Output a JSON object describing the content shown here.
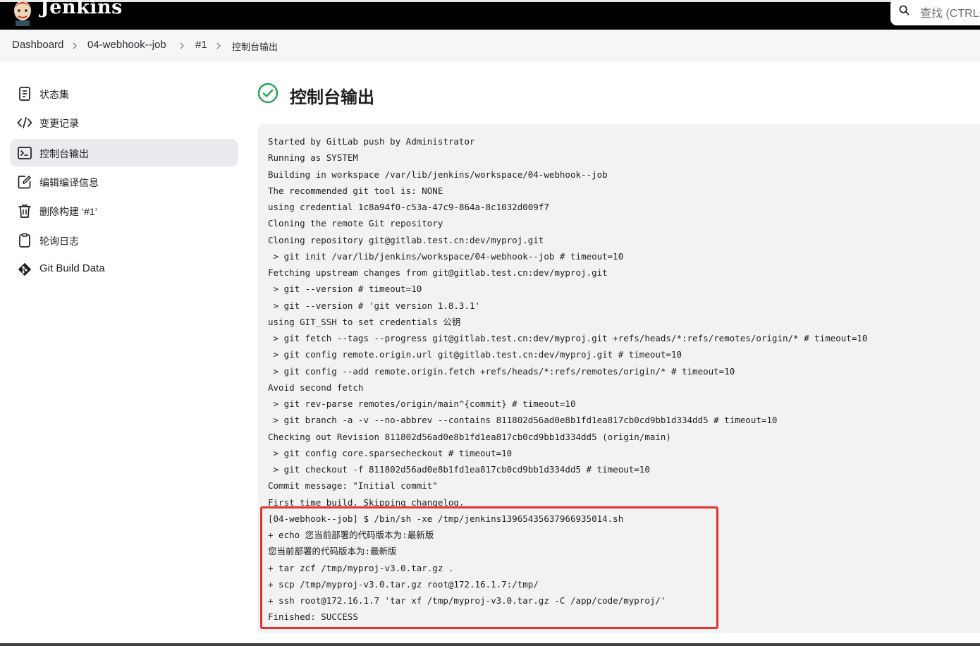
{
  "header": {
    "brand": "Jenkins",
    "search_placeholder": "查找 (CTRL+K)"
  },
  "breadcrumb": [
    {
      "label": "Dashboard"
    },
    {
      "label": "04-webhook--job"
    },
    {
      "label": "#1"
    },
    {
      "label": "控制台输出"
    }
  ],
  "sidebar": {
    "items": [
      {
        "label": "状态集",
        "icon": "document-icon",
        "active": false
      },
      {
        "label": "变更记录",
        "icon": "code-icon",
        "active": false
      },
      {
        "label": "控制台输出",
        "icon": "terminal-icon",
        "active": true
      },
      {
        "label": "编辑编译信息",
        "icon": "edit-icon",
        "active": false
      },
      {
        "label": "删除构建 ‘#1’",
        "icon": "trash-icon",
        "active": false
      },
      {
        "label": "轮询日志",
        "icon": "clipboard-icon",
        "active": false
      },
      {
        "label": "Git Build Data",
        "icon": "git-icon",
        "active": false
      }
    ]
  },
  "main": {
    "title": "控制台输出",
    "status_icon": "success-check-icon",
    "console_lines": [
      "Started by GitLab push by Administrator",
      "Running as SYSTEM",
      "Building in workspace /var/lib/jenkins/workspace/04-webhook--job",
      "The recommended git tool is: NONE",
      "using credential 1c8a94f0-c53a-47c9-864a-8c1032d009f7",
      "Cloning the remote Git repository",
      "Cloning repository git@gitlab.test.cn:dev/myproj.git",
      " > git init /var/lib/jenkins/workspace/04-webhook--job # timeout=10",
      "Fetching upstream changes from git@gitlab.test.cn:dev/myproj.git",
      " > git --version # timeout=10",
      " > git --version # 'git version 1.8.3.1'",
      "using GIT_SSH to set credentials 公钥",
      " > git fetch --tags --progress git@gitlab.test.cn:dev/myproj.git +refs/heads/*:refs/remotes/origin/* # timeout=10",
      " > git config remote.origin.url git@gitlab.test.cn:dev/myproj.git # timeout=10",
      " > git config --add remote.origin.fetch +refs/heads/*:refs/remotes/origin/* # timeout=10",
      "Avoid second fetch",
      " > git rev-parse remotes/origin/main^{commit} # timeout=10",
      " > git branch -a -v --no-abbrev --contains 811802d56ad0e8b1fd1ea817cb0cd9bb1d334dd5 # timeout=10",
      "Checking out Revision 811802d56ad0e8b1fd1ea817cb0cd9bb1d334dd5 (origin/main)",
      " > git config core.sparsecheckout # timeout=10",
      " > git checkout -f 811802d56ad0e8b1fd1ea817cb0cd9bb1d334dd5 # timeout=10",
      "Commit message: \"Initial commit\"",
      "First time build. Skipping changelog.",
      "[04-webhook--job] $ /bin/sh -xe /tmp/jenkins13965435637966935014.sh",
      "+ echo 您当前部署的代码版本为:最新版",
      "您当前部署的代码版本为:最新版",
      "+ tar zcf /tmp/myproj-v3.0.tar.gz .",
      "+ scp /tmp/myproj-v3.0.tar.gz root@172.16.1.7:/tmp/",
      "+ ssh root@172.16.1.7 'tar xf /tmp/myproj-v3.0.tar.gz -C /app/code/myproj/'",
      "Finished: SUCCESS"
    ]
  },
  "colors": {
    "header_bg": "#000000",
    "success_green": "#1ea64b",
    "highlight_red": "#e8312f"
  }
}
